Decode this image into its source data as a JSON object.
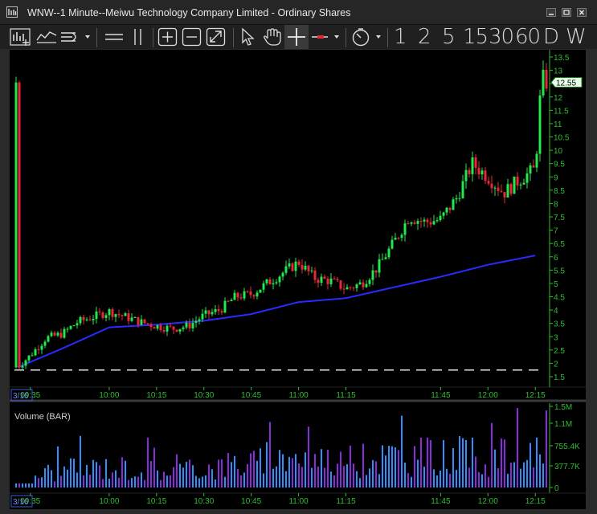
{
  "window": {
    "title": "WNW--1 Minute--Meiwu Technology Company Limited - Ordinary Shares"
  },
  "toolbar": {
    "icons": [
      "bar-style-icon",
      "line-style-icon",
      "indicator-menu-icon",
      "horizontal-line-icon",
      "vertical-line-icon",
      "zoom-in-icon",
      "zoom-out-icon",
      "zoom-fit-icon",
      "pointer-icon",
      "pan-hand-icon",
      "crosshair-icon",
      "price-line-icon",
      "clock-icon"
    ],
    "periods": [
      "1",
      "2",
      "5",
      "15",
      "30",
      "60",
      "D",
      "W"
    ]
  },
  "price_pane": {
    "last_price": "12.55",
    "date_label": "3/16",
    "y_ticks": [
      "13.5",
      "13",
      "12.5",
      "12",
      "11.5",
      "11",
      "10.5",
      "10",
      "9.5",
      "9",
      "8.5",
      "8",
      "7.5",
      "7",
      "6.5",
      "6",
      "5.5",
      "5",
      "4.5",
      "4",
      "3.5",
      "3",
      "2.5",
      "2",
      "1.5"
    ],
    "x_ticks": [
      "09:35",
      "10:00",
      "10:15",
      "10:30",
      "10:45",
      "11:00",
      "11:15",
      "11:45",
      "12:00",
      "12:15"
    ]
  },
  "volume_pane": {
    "title": "Volume (BAR)",
    "date_label": "3/16",
    "y_ticks": [
      "1.5M",
      "1.1M",
      "755.4K",
      "377.7K",
      "0"
    ],
    "x_ticks": [
      "09:35",
      "10:00",
      "10:15",
      "10:30",
      "10:45",
      "11:00",
      "11:15",
      "11:45",
      "12:00",
      "12:15"
    ]
  },
  "colors": {
    "up": "#22e84a",
    "down": "#e8283a",
    "ma": "#2a2aff",
    "vol_up": "#2f8fff",
    "vol_down": "#8a2be2",
    "axis": "#2fbf2f",
    "background": "#000000"
  },
  "chart_data": {
    "type": "candlestick",
    "price_range": [
      1.5,
      13.5
    ],
    "ohlc_close_path": [
      {
        "time": "09:31",
        "close": 1.85
      },
      {
        "time": "09:35",
        "close": 2.3
      },
      {
        "time": "09:40",
        "close": 2.95
      },
      {
        "time": "09:45",
        "close": 3.1
      },
      {
        "time": "09:50",
        "close": 3.55
      },
      {
        "time": "10:00",
        "close": 3.95
      },
      {
        "time": "10:05",
        "close": 3.75
      },
      {
        "time": "10:10",
        "close": 3.55
      },
      {
        "time": "10:15",
        "close": 3.4
      },
      {
        "time": "10:20",
        "close": 3.3
      },
      {
        "time": "10:25",
        "close": 3.4
      },
      {
        "time": "10:30",
        "close": 3.8
      },
      {
        "time": "10:35",
        "close": 4.0
      },
      {
        "time": "10:40",
        "close": 4.5
      },
      {
        "time": "10:45",
        "close": 4.6
      },
      {
        "time": "10:50",
        "close": 5.0
      },
      {
        "time": "10:55",
        "close": 5.4
      },
      {
        "time": "11:00",
        "close": 5.8
      },
      {
        "time": "11:05",
        "close": 5.2
      },
      {
        "time": "11:10",
        "close": 5.1
      },
      {
        "time": "11:15",
        "close": 4.8
      },
      {
        "time": "11:20",
        "close": 5.0
      },
      {
        "time": "11:25",
        "close": 5.6
      },
      {
        "time": "11:30",
        "close": 6.5
      },
      {
        "time": "11:35",
        "close": 7.5
      },
      {
        "time": "11:40",
        "close": 7.3
      },
      {
        "time": "11:45",
        "close": 7.4
      },
      {
        "time": "11:50",
        "close": 8.2
      },
      {
        "time": "11:55",
        "close": 9.5
      },
      {
        "time": "12:00",
        "close": 9.0
      },
      {
        "time": "12:05",
        "close": 8.4
      },
      {
        "time": "12:10",
        "close": 8.9
      },
      {
        "time": "12:15",
        "close": 9.3
      },
      {
        "time": "12:17",
        "close": 12.8
      },
      {
        "time": "12:18",
        "close": 12.55
      }
    ],
    "moving_average": [
      {
        "time": "09:31",
        "value": 1.85
      },
      {
        "time": "09:45",
        "value": 2.55
      },
      {
        "time": "10:00",
        "value": 3.35
      },
      {
        "time": "10:15",
        "value": 3.45
      },
      {
        "time": "10:30",
        "value": 3.6
      },
      {
        "time": "10:45",
        "value": 3.85
      },
      {
        "time": "11:00",
        "value": 4.3
      },
      {
        "time": "11:15",
        "value": 4.45
      },
      {
        "time": "11:30",
        "value": 4.85
      },
      {
        "time": "11:45",
        "value": 5.25
      },
      {
        "time": "12:00",
        "value": 5.7
      },
      {
        "time": "12:15",
        "value": 6.05
      }
    ],
    "volume_range": [
      0,
      1500000
    ]
  }
}
